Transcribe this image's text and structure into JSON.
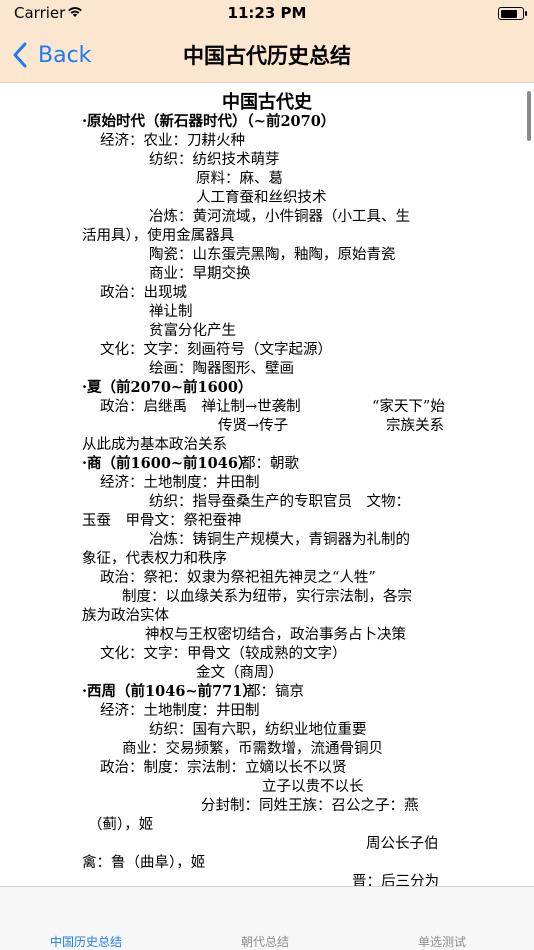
{
  "status_bar": {
    "carrier": "Carrier",
    "time": "11:23 PM",
    "battery_level_pct": 90
  },
  "nav": {
    "back_label": "Back",
    "title": "中国古代历史总结"
  },
  "doc": {
    "title": "中国古代史",
    "lines": [
      "·原始时代（新石器时代）（~前2070）",
      "经济：农业：刀耕火种",
      "纺织：纺织技术萌芽",
      "原料：麻、葛",
      "人工育蚕和丝织技术",
      "冶炼：黄河流域，小件铜器（小工具、生",
      "活用具），使用金属器具",
      "陶瓷：山东蛋壳黑陶，釉陶，原始青瓷",
      "商业：早期交换",
      "政治：出现城",
      "禅让制",
      "贫富分化产生",
      "文化：文字：刻画符号（文字起源）",
      "绘画：陶器图形、壁画",
      "·夏（前2070~前1600）",
      "政治：启继禹　禅让制→世袭制",
      "“家天下”始",
      "传贤→传子",
      "宗族关系",
      "从此成为基本政治关系",
      "·商（前1600~前1046）",
      "都：朝歌",
      "经济：土地制度：井田制",
      "纺织：指导蚕桑生产的专职官员　文物：",
      "玉蚕　甲骨文：祭祀蚕神",
      "冶炼：铸铜生产规模大，青铜器为礼制的",
      "象征，代表权力和秩序",
      "政治：祭祀：奴隶为祭祀祖先神灵之“人牲”",
      "制度：以血缘关系为纽带，实行宗法制，各宗",
      "族为政治实体",
      "神权与王权密切结合，政治事务占卜决策",
      "文化：文字：甲骨文（较成熟的文字）",
      "金文（商周）",
      "·西周（前1046~前771）",
      "都：镐京",
      "经济：土地制度：井田制",
      "纺织：国有六职，纺织业地位重要",
      "商业：交易频繁，币需数增，流通骨铜贝",
      "政治：制度：宗法制：立嫡以长不以贤",
      "立子以贵不以长",
      "分封制：同姓王族：召公之子：燕",
      "（蓟），姬",
      "周公长子伯",
      "禽：鲁（曲阜），姬",
      "晋：后三分为"
    ]
  },
  "tabs": [
    {
      "label": "中国历史总结",
      "active": true
    },
    {
      "label": "朝代总结",
      "active": false
    },
    {
      "label": "单选测试",
      "active": false
    }
  ],
  "colors": {
    "accent": "#1e7cf4",
    "bar_background": "#fbe6d0",
    "inactive_tab": "#8e8e93"
  }
}
